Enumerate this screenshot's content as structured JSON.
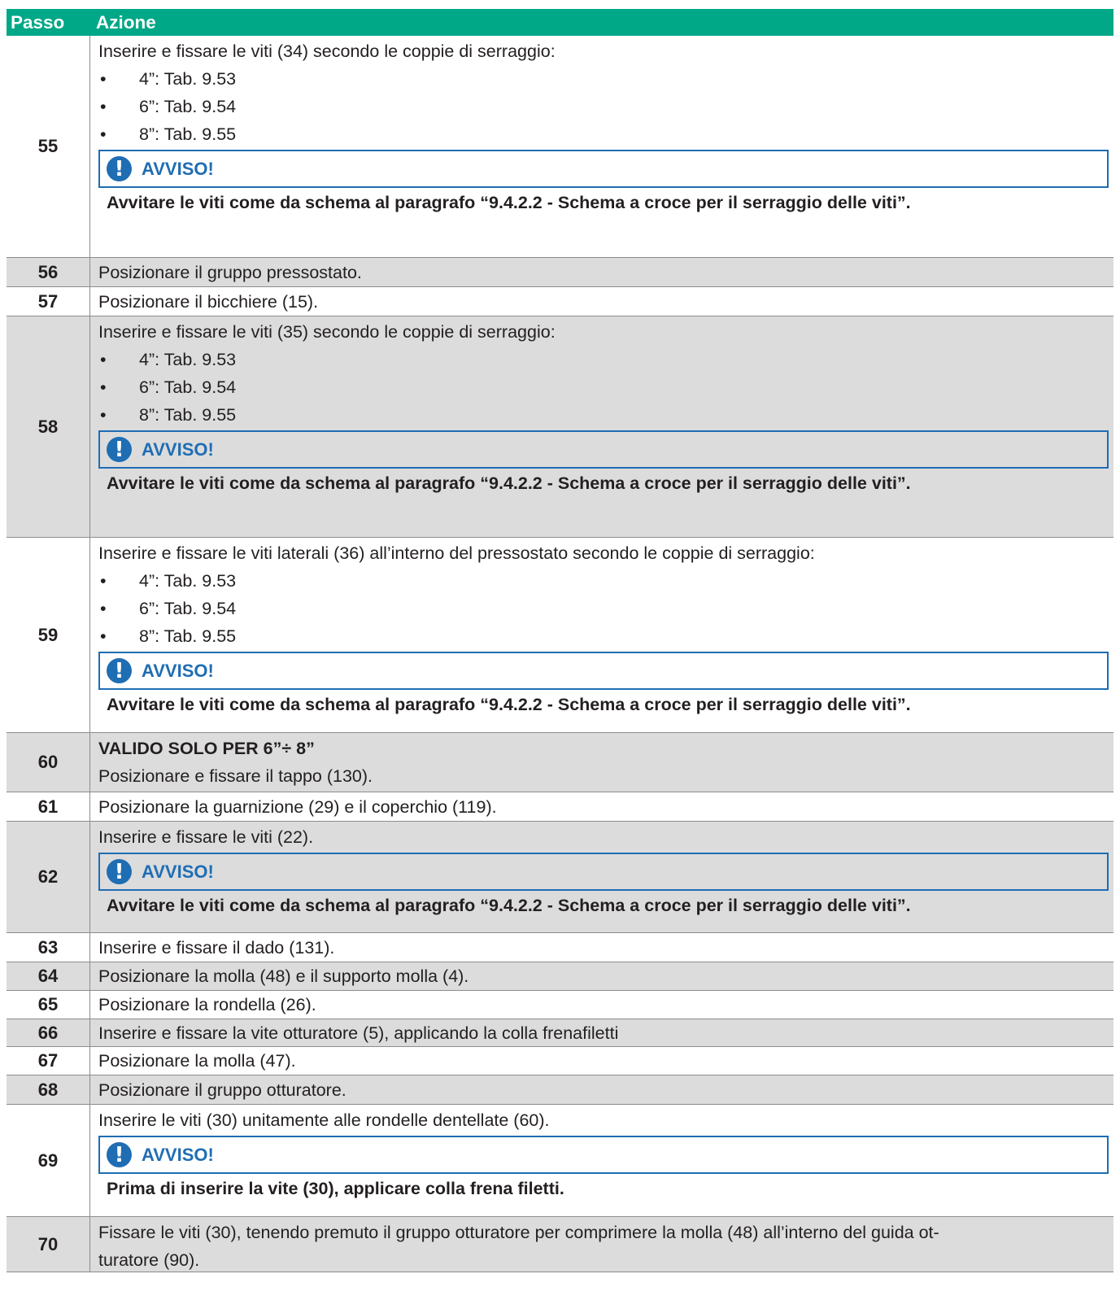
{
  "header": {
    "step": "Passo",
    "action": "Azione"
  },
  "notice_title": "AVVISO!",
  "notice_icon": "exclamation-icon",
  "colors": {
    "header": "#00a887",
    "notice": "#1f6db3",
    "gray_row": "#dcdcdd"
  },
  "rows": [
    {
      "step": "55",
      "lines": [
        "Inserire e fissare le viti (34) secondo le coppie di serraggio:"
      ],
      "bullets": [
        "4”: Tab. 9.53",
        "6”: Tab. 9.54",
        "8”: Tab. 9.55"
      ],
      "notice": "Avvitare le viti come da schema al paragrafo “9.4.2.2  - Schema a croce per il serraggio delle viti”."
    },
    {
      "step": "56",
      "lines": [
        "Posizionare il gruppo pressostato."
      ]
    },
    {
      "step": "57",
      "lines": [
        "Posizionare il bicchiere (15)."
      ]
    },
    {
      "step": "58",
      "lines": [
        "Inserire e fissare le viti (35) secondo le coppie di serraggio:"
      ],
      "bullets": [
        "4”: Tab. 9.53",
        "6”: Tab. 9.54",
        "8”: Tab. 9.55"
      ],
      "notice": "Avvitare le viti come da schema al paragrafo “9.4.2.2  - Schema a croce per il serraggio delle viti”."
    },
    {
      "step": "59",
      "lines": [
        "Inserire e fissare le viti laterali (36) all’interno del pressostato secondo le coppie di serraggio:"
      ],
      "bullets": [
        "4”: Tab. 9.53",
        "6”: Tab. 9.54",
        "8”: Tab. 9.55"
      ],
      "notice": "Avvitare le viti come da schema al paragrafo “9.4.2.2  - Schema a croce per il serraggio delle viti”."
    },
    {
      "step": "60",
      "bold_line": "VALIDO SOLO PER 6”÷ 8”",
      "lines": [
        "Posizionare e fissare il tappo (130)."
      ]
    },
    {
      "step": "61",
      "lines": [
        "Posizionare la guarnizione (29) e il coperchio (119)."
      ]
    },
    {
      "step": "62",
      "lines": [
        "Inserire e fissare le viti (22)."
      ],
      "notice": "Avvitare le viti come da schema al paragrafo “9.4.2.2  - Schema a croce per il serraggio delle viti”."
    },
    {
      "step": "63",
      "lines": [
        "Inserire e fissare il dado (131)."
      ]
    },
    {
      "step": "64",
      "lines": [
        "Posizionare la molla (48) e il supporto molla (4)."
      ]
    },
    {
      "step": "65",
      "lines": [
        "Posizionare la rondella (26)."
      ]
    },
    {
      "step": "66",
      "lines": [
        "Inserire e fissare la vite otturatore (5), applicando la colla frenafiletti"
      ]
    },
    {
      "step": "67",
      "lines": [
        "Posizionare la molla (47)."
      ]
    },
    {
      "step": "68",
      "lines": [
        "Posizionare il gruppo otturatore."
      ]
    },
    {
      "step": "69",
      "lines": [
        "Inserire le viti (30) unitamente alle rondelle dentellate (60)."
      ],
      "notice": "Prima di inserire la vite (30), applicare colla frena filetti."
    },
    {
      "step": "70",
      "lines": [
        "Fissare le viti (30), tenendo premuto il gruppo otturatore per comprimere la molla (48) all’interno del guida ot-",
        "turatore (90)."
      ]
    }
  ]
}
